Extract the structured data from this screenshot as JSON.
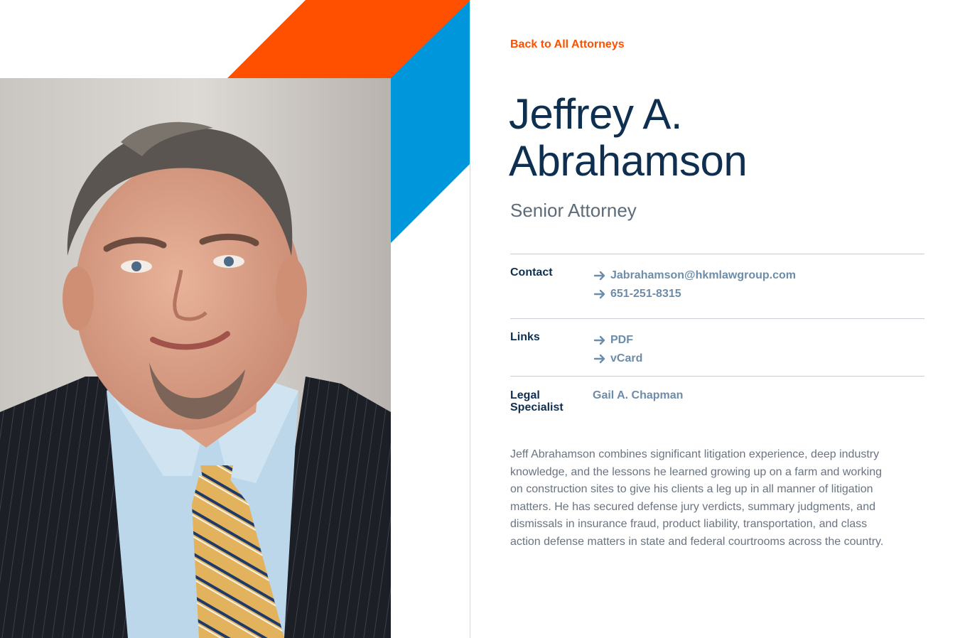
{
  "back_link": {
    "label": "Back to All Attorneys"
  },
  "attorney": {
    "name_line1": "Jeffrey A.",
    "name_line2": "Abrahamson",
    "title": "Senior Attorney",
    "bio": "Jeff Abrahamson combines significant litigation experience, deep industry knowledge, and the lessons he learned growing up on a farm and working on construction sites to give his clients a leg up in all manner of litigation matters. He has secured defense jury verdicts, summary judgments, and dismissals in insurance fraud, product liability, transportation, and class action defense matters in state and federal courtrooms across the country."
  },
  "contact": {
    "label": "Contact",
    "email": "Jabrahamson@hkmlawgroup.com",
    "phone": "651-251-8315"
  },
  "links": {
    "label": "Links",
    "pdf": "PDF",
    "vcard": "vCard"
  },
  "legal_specialist": {
    "label_line1": "Legal",
    "label_line2": "Specialist",
    "name": "Gail A. Chapman"
  },
  "icons": {
    "link_arrow": "arrow-right-icon"
  },
  "colors": {
    "accent_orange": "#ff5000",
    "accent_blue": "#0096dc",
    "navy": "#0e2f50",
    "link_gray_blue": "#6d8ca8"
  }
}
